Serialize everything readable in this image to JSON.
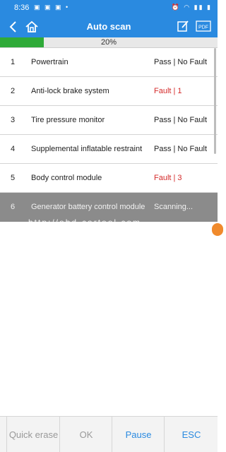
{
  "status_bar": {
    "time": "8:36",
    "notifications": "▣ ▣ ▣ •",
    "right_icons": "⏰ ◠ ▮▮ ▮"
  },
  "nav": {
    "title": "Auto scan",
    "back_icon": "back-icon",
    "home_icon": "home-icon",
    "edit_icon": "edit-icon",
    "pdf_icon": "pdf-icon",
    "pdf_label": "PDF"
  },
  "progress": {
    "value": 0.2,
    "label": "20%",
    "color": "#2faa38"
  },
  "rows": [
    {
      "num": "1",
      "name": "Powertrain",
      "status": "Pass | No Fault",
      "fault": false
    },
    {
      "num": "2",
      "name": "Anti-lock brake system",
      "status": "Fault | 1",
      "fault": true
    },
    {
      "num": "3",
      "name": "Tire pressure monitor",
      "status": "Pass | No Fault",
      "fault": false
    },
    {
      "num": "4",
      "name": "Supplemental inflatable restraint",
      "status": "Pass | No Fault",
      "fault": false
    },
    {
      "num": "5",
      "name": "Body control module",
      "status": "Fault | 3",
      "fault": true
    },
    {
      "num": "6",
      "name": "Generator battery control module",
      "status": "Scanning...",
      "fault": false,
      "active": true
    }
  ],
  "watermark": "http://obd-cartool.com",
  "buttons": {
    "quick_erase": "Quick erase",
    "ok": "OK",
    "pause": "Pause",
    "esc": "ESC"
  },
  "colors": {
    "header": "#2a8ae0",
    "fault": "#d42a2a",
    "active_row": "#8b8b8b"
  }
}
